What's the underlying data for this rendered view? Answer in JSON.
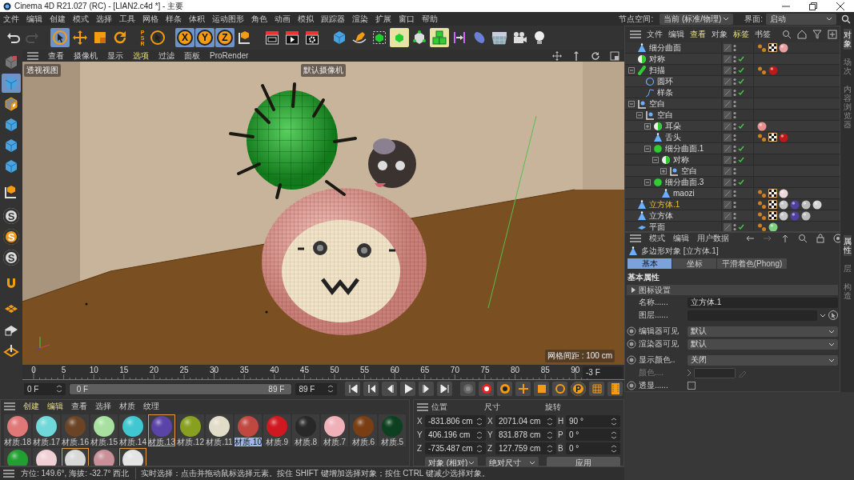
{
  "window": {
    "title": "Cinema 4D R21.027 (RC) - [LIAN2.c4d *] - 主要"
  },
  "menubar": {
    "items": [
      "文件",
      "编辑",
      "创建",
      "模式",
      "选择",
      "工具",
      "网格",
      "样条",
      "体积",
      "运动图形",
      "角色",
      "动画",
      "模拟",
      "跟踪器",
      "渲染",
      "扩展",
      "窗口",
      "帮助"
    ],
    "node_space": {
      "label": "节点空间:",
      "value": "当前 (标准/物理)"
    },
    "interface": {
      "label": "界面:",
      "value": "启动"
    }
  },
  "toolbar": [
    {
      "kind": "undo",
      "selected": false,
      "highlighted": false,
      "disabled": false
    },
    {
      "kind": "redo",
      "selected": false,
      "highlighted": false,
      "disabled": true
    },
    {
      "kind": "select",
      "selected": true,
      "highlighted": false,
      "disabled": false
    },
    {
      "kind": "move",
      "selected": false,
      "highlighted": false,
      "disabled": false
    },
    {
      "kind": "scale",
      "selected": false,
      "highlighted": false,
      "disabled": false
    },
    {
      "kind": "rotate",
      "selected": false,
      "highlighted": false,
      "disabled": false
    },
    {
      "kind": "psr",
      "selected": false,
      "highlighted": false,
      "disabled": false,
      "label": "PSR"
    },
    {
      "kind": "select",
      "selected": false,
      "highlighted": false,
      "disabled": false
    },
    {
      "kind": "axis",
      "selected": true,
      "highlighted": false,
      "disabled": false,
      "label": "X"
    },
    {
      "kind": "axis",
      "selected": true,
      "highlighted": false,
      "disabled": false,
      "label": "Y"
    },
    {
      "kind": "axis",
      "selected": true,
      "highlighted": false,
      "disabled": false,
      "label": "Z"
    },
    {
      "kind": "coord",
      "selected": false,
      "highlighted": false,
      "disabled": false
    },
    {
      "kind": "render-view",
      "selected": false,
      "highlighted": false,
      "disabled": false
    },
    {
      "kind": "render",
      "selected": false,
      "highlighted": false,
      "disabled": false
    },
    {
      "kind": "render-settings",
      "selected": false,
      "highlighted": false,
      "disabled": false
    },
    {
      "kind": "cube",
      "selected": false,
      "highlighted": false,
      "disabled": false
    },
    {
      "kind": "pen",
      "selected": false,
      "highlighted": false,
      "disabled": false
    },
    {
      "kind": "subdiv",
      "selected": false,
      "highlighted": false,
      "disabled": false
    },
    {
      "kind": "subdiv",
      "selected": false,
      "highlighted": true,
      "disabled": false
    },
    {
      "kind": "generator",
      "selected": false,
      "highlighted": false,
      "disabled": false
    },
    {
      "kind": "cloner",
      "selected": false,
      "highlighted": true,
      "disabled": false
    },
    {
      "kind": "deformer",
      "selected": false,
      "highlighted": false,
      "disabled": false
    },
    {
      "kind": "ellipse",
      "selected": false,
      "highlighted": false,
      "disabled": false
    },
    {
      "kind": "floor",
      "selected": false,
      "highlighted": false,
      "disabled": false
    },
    {
      "kind": "camera",
      "selected": false,
      "highlighted": false,
      "disabled": false
    },
    {
      "kind": "light",
      "selected": false,
      "highlighted": false,
      "disabled": false
    }
  ],
  "left_toolbar": [
    {
      "kind": "model",
      "selected": false,
      "highlighted": false
    },
    {
      "kind": "cube",
      "selected": true,
      "highlighted": false
    },
    {
      "kind": "texture",
      "selected": false,
      "highlighted": false
    },
    {
      "kind": "cube",
      "selected": false,
      "highlighted": false
    },
    {
      "kind": "cube",
      "selected": false,
      "highlighted": false
    },
    {
      "kind": "cube",
      "selected": false,
      "highlighted": false
    },
    {
      "kind": "coord",
      "selected": false,
      "highlighted": false
    },
    {
      "kind": "snap",
      "selected": false,
      "highlighted": false,
      "label": "S"
    },
    {
      "kind": "snap",
      "selected": false,
      "highlighted": true,
      "label": "S"
    },
    {
      "kind": "snap",
      "selected": false,
      "highlighted": false,
      "label": "S"
    },
    {
      "kind": "magnet",
      "selected": false,
      "highlighted": false
    },
    {
      "kind": "grid",
      "selected": false,
      "highlighted": false
    },
    {
      "kind": "lockgrid",
      "selected": false,
      "highlighted": false
    },
    {
      "kind": "workplane",
      "selected": false,
      "highlighted": false
    }
  ],
  "viewport": {
    "menu": [
      {
        "label": "查看",
        "highlighted": false
      },
      {
        "label": "摄像机",
        "highlighted": false
      },
      {
        "label": "显示",
        "highlighted": false
      },
      {
        "label": "选项",
        "highlighted": true
      },
      {
        "label": "过滤",
        "highlighted": false
      },
      {
        "label": "面板",
        "highlighted": false
      },
      {
        "label": "ProRender",
        "highlighted": false
      }
    ],
    "view_label": "透视视图",
    "camera_label": "默认摄像机",
    "grid_label": "网格间距 : 100 cm"
  },
  "timeline": {
    "ticks": [
      "0",
      "5",
      "10",
      "15",
      "20",
      "25",
      "30",
      "35",
      "40",
      "45",
      "50",
      "55",
      "60",
      "65",
      "70",
      "75",
      "80",
      "85",
      "90"
    ],
    "current": "-3 F"
  },
  "transport": {
    "start": "0 F",
    "range_start": "0 F",
    "range_end": "89 F",
    "end": "89 F",
    "level": 1,
    "buttons": [
      {
        "kind": "first"
      },
      {
        "kind": "prev-key"
      },
      {
        "kind": "prev"
      },
      {
        "kind": "play"
      },
      {
        "kind": "next"
      },
      {
        "kind": "last"
      },
      {
        "kind": "record-off"
      },
      {
        "kind": "record"
      },
      {
        "kind": "autokey"
      },
      {
        "kind": "move"
      },
      {
        "kind": "scale"
      },
      {
        "kind": "rotate"
      },
      {
        "kind": "param",
        "label": "P"
      },
      {
        "kind": "grid"
      },
      {
        "kind": "film"
      }
    ]
  },
  "materials": {
    "menu": [
      {
        "label": "创建",
        "highlighted": true
      },
      {
        "label": "编辑",
        "highlighted": true
      },
      {
        "label": "查看",
        "highlighted": false
      },
      {
        "label": "选择",
        "highlighted": false
      },
      {
        "label": "材质",
        "highlighted": false
      },
      {
        "label": "纹理",
        "highlighted": false
      }
    ],
    "items": [
      {
        "name": "材质.18",
        "color": "#e07878",
        "selected": false,
        "in_use": false
      },
      {
        "name": "材质.17",
        "color": "#70d8d8",
        "selected": false,
        "in_use": false
      },
      {
        "name": "材质.16",
        "color": "#6a4424",
        "selected": false,
        "in_use": false
      },
      {
        "name": "材质.15",
        "color": "#a8e0a0",
        "selected": false,
        "in_use": false
      },
      {
        "name": "材质.14",
        "color": "#40c8d0",
        "selected": false,
        "in_use": false
      },
      {
        "name": "材质.13",
        "color": "#5a44a8",
        "selected": false,
        "in_use": true
      },
      {
        "name": "材质.12",
        "color": "#88a020",
        "selected": false,
        "in_use": false
      },
      {
        "name": "材质.11",
        "color": "#e0dcc8",
        "selected": false,
        "in_use": false
      },
      {
        "name": "材质.10",
        "color": "#c04840",
        "selected": true,
        "in_use": false
      },
      {
        "name": "材质.9",
        "color": "#d01820",
        "selected": false,
        "in_use": false
      },
      {
        "name": "材质.8",
        "color": "#282828",
        "selected": false,
        "in_use": false
      },
      {
        "name": "材质.7",
        "color": "#f0b0b8",
        "selected": false,
        "in_use": false
      },
      {
        "name": "材质.6",
        "color": "#7a3e14",
        "selected": false,
        "in_use": false
      },
      {
        "name": "材质.5",
        "color": "#0c4020",
        "selected": false,
        "in_use": false
      },
      {
        "color": "#20a030",
        "selected": false,
        "in_use": false
      },
      {
        "color": "#f0d0d4",
        "selected": false,
        "in_use": false
      },
      {
        "color": "#d8d8d8",
        "selected": false,
        "in_use": true
      },
      {
        "color": "#c89098",
        "selected": false,
        "in_use": false
      },
      {
        "color": "#e4e4e4",
        "selected": false,
        "in_use": true
      }
    ]
  },
  "coordinates": {
    "headers": [
      "位置",
      "尺寸",
      "旋转"
    ],
    "rows": [
      {
        "axis_1": "X",
        "position": "-831.806 cm",
        "axis_2": "X",
        "size": "2071.04 cm",
        "axis_3": "H",
        "rotation": "90 °"
      },
      {
        "axis_1": "Y",
        "position": "406.196 cm",
        "axis_2": "Y",
        "size": "831.878 cm",
        "axis_3": "P",
        "rotation": "0 °"
      },
      {
        "axis_1": "Z",
        "position": "-735.487 cm",
        "axis_2": "Z",
        "size": "127.759 cm",
        "axis_3": "B",
        "rotation": "0 °"
      }
    ],
    "mode": "对象 (相对)",
    "size_mode": "绝对尺寸",
    "apply": "应用"
  },
  "status_bar": [
    "方位: 149.6°, 海拔: -32.7°  西北",
    "实时选择：点击并拖动鼠标选择元素。按住 SHIFT 键增加选择对象；按住 CTRL 键减少选择对象。"
  ],
  "objects": {
    "menu": [
      {
        "label": "文件",
        "highlighted": false
      },
      {
        "label": "编辑",
        "highlighted": false
      },
      {
        "label": "查看",
        "highlighted": true
      },
      {
        "label": "对象",
        "highlighted": false
      },
      {
        "label": "标签",
        "highlighted": true
      },
      {
        "label": "书签",
        "highlighted": false
      }
    ],
    "tree": [
      {
        "name": "细分曲面",
        "kind": "polygon",
        "selected": false,
        "enabled": false,
        "tags": [
          {
            "kind": "phong"
          },
          {
            "kind": "uvw"
          },
          {
            "kind": "material",
            "color": "#e8a0a0"
          }
        ]
      },
      {
        "name": "对称",
        "kind": "symmetry",
        "selected": false,
        "enabled": true
      },
      {
        "name": "扫描",
        "kind": "sweep",
        "expanded": true,
        "selected": false,
        "enabled": true,
        "tags": [
          {
            "kind": "phong"
          },
          {
            "kind": "material",
            "color": "#c01818"
          }
        ],
        "children": [
          {
            "name": "圆环",
            "kind": "circle",
            "selected": false,
            "enabled": true
          },
          {
            "name": "样条",
            "kind": "spline",
            "selected": false,
            "enabled": true
          }
        ]
      },
      {
        "name": "空白",
        "kind": "null",
        "expanded": true,
        "selected": false,
        "enabled": false,
        "children": [
          {
            "name": "空白",
            "kind": "null",
            "expanded": true,
            "selected": false,
            "enabled": false,
            "children": [
              {
                "name": "耳朵",
                "kind": "symmetry",
                "expanded": false,
                "selected": false,
                "enabled": true,
                "tags": [
                  {
                    "kind": "material",
                    "color": "#e89090"
                  }
                ]
              },
              {
                "name": "舌头",
                "kind": "polygon",
                "selected": false,
                "enabled": false,
                "tags": [
                  {
                    "kind": "phong"
                  },
                  {
                    "kind": "uvw"
                  },
                  {
                    "kind": "material",
                    "color": "#c01818"
                  }
                ]
              },
              {
                "name": "细分曲面.1",
                "kind": "subdiv",
                "expanded": true,
                "selected": false,
                "enabled": true,
                "children": [
                  {
                    "name": "对称",
                    "kind": "symmetry",
                    "expanded": true,
                    "selected": false,
                    "enabled": true,
                    "children": [
                      {
                        "name": "空白",
                        "kind": "null",
                        "expanded": false,
                        "selected": false,
                        "enabled": false
                      }
                    ]
                  }
                ]
              },
              {
                "name": "细分曲面.3",
                "kind": "subdiv",
                "expanded": true,
                "selected": false,
                "enabled": true,
                "children": [
                  {
                    "name": "maozi",
                    "kind": "polygon",
                    "selected": false,
                    "enabled": false,
                    "tags": [
                      {
                        "kind": "phong"
                      },
                      {
                        "kind": "uvw"
                      },
                      {
                        "kind": "material",
                        "color": "#f0d8d8"
                      }
                    ]
                  }
                ]
              }
            ]
          }
        ]
      },
      {
        "name": "立方体.1",
        "kind": "polygon",
        "selected": true,
        "enabled": false,
        "tags": [
          {
            "kind": "phong"
          },
          {
            "kind": "uvw"
          },
          {
            "kind": "material",
            "color": "#c8c8c8"
          },
          {
            "kind": "material",
            "color": "#5040a0"
          },
          {
            "kind": "material",
            "color": "#bcbcbc"
          },
          {
            "kind": "material",
            "color": "#d4d4d4"
          }
        ]
      },
      {
        "name": "立方体",
        "kind": "polygon",
        "selected": false,
        "enabled": false,
        "tags": [
          {
            "kind": "phong"
          },
          {
            "kind": "uvw"
          },
          {
            "kind": "material",
            "color": "#c8c8c8"
          },
          {
            "kind": "material",
            "color": "#5040a0"
          },
          {
            "kind": "material",
            "color": "#bcbcbc"
          }
        ]
      },
      {
        "name": "平面",
        "kind": "plane",
        "selected": false,
        "enabled": true,
        "tags": [
          {
            "kind": "phong"
          },
          {
            "kind": "material",
            "color": "#80d080"
          }
        ]
      }
    ],
    "side_tabs": [
      {
        "label": "对象",
        "selected": true
      },
      {
        "label": "场次",
        "selected": false
      },
      {
        "label": "内容浏览器",
        "selected": false
      }
    ]
  },
  "attributes": {
    "menu": [
      "模式",
      "编辑",
      "用户数据"
    ],
    "object_title": "多边形对象 [立方体.1]",
    "tabs": [
      {
        "label": "基本",
        "selected": true
      },
      {
        "label": "坐标",
        "selected": false
      },
      {
        "label": "平滑着色(Phong)",
        "selected": false
      }
    ],
    "section": "基本属性",
    "group": "图标设置",
    "fields": [
      {
        "label": "名称......",
        "kind": "text",
        "value": "立方体.1",
        "animatable": false,
        "disabled": false
      },
      {
        "label": "图层......",
        "kind": "layer",
        "animatable": false,
        "disabled": false
      },
      {
        "label": "编辑器可见",
        "kind": "select",
        "value": "默认",
        "animatable": true,
        "disabled": false
      },
      {
        "label": "渲染器可见",
        "kind": "select",
        "value": "默认",
        "animatable": true,
        "disabled": false
      },
      {
        "label": "显示颜色..",
        "kind": "select",
        "value": "关闭",
        "animatable": true,
        "disabled": false
      },
      {
        "label": "颜色....",
        "kind": "color",
        "animatable": false,
        "disabled": true
      },
      {
        "label": "透显......",
        "kind": "checkbox",
        "checked": false,
        "animatable": true,
        "disabled": false
      }
    ],
    "side_tabs": [
      {
        "label": "属性",
        "selected": true
      },
      {
        "label": "层",
        "selected": false
      },
      {
        "label": "构造",
        "selected": false
      }
    ]
  }
}
